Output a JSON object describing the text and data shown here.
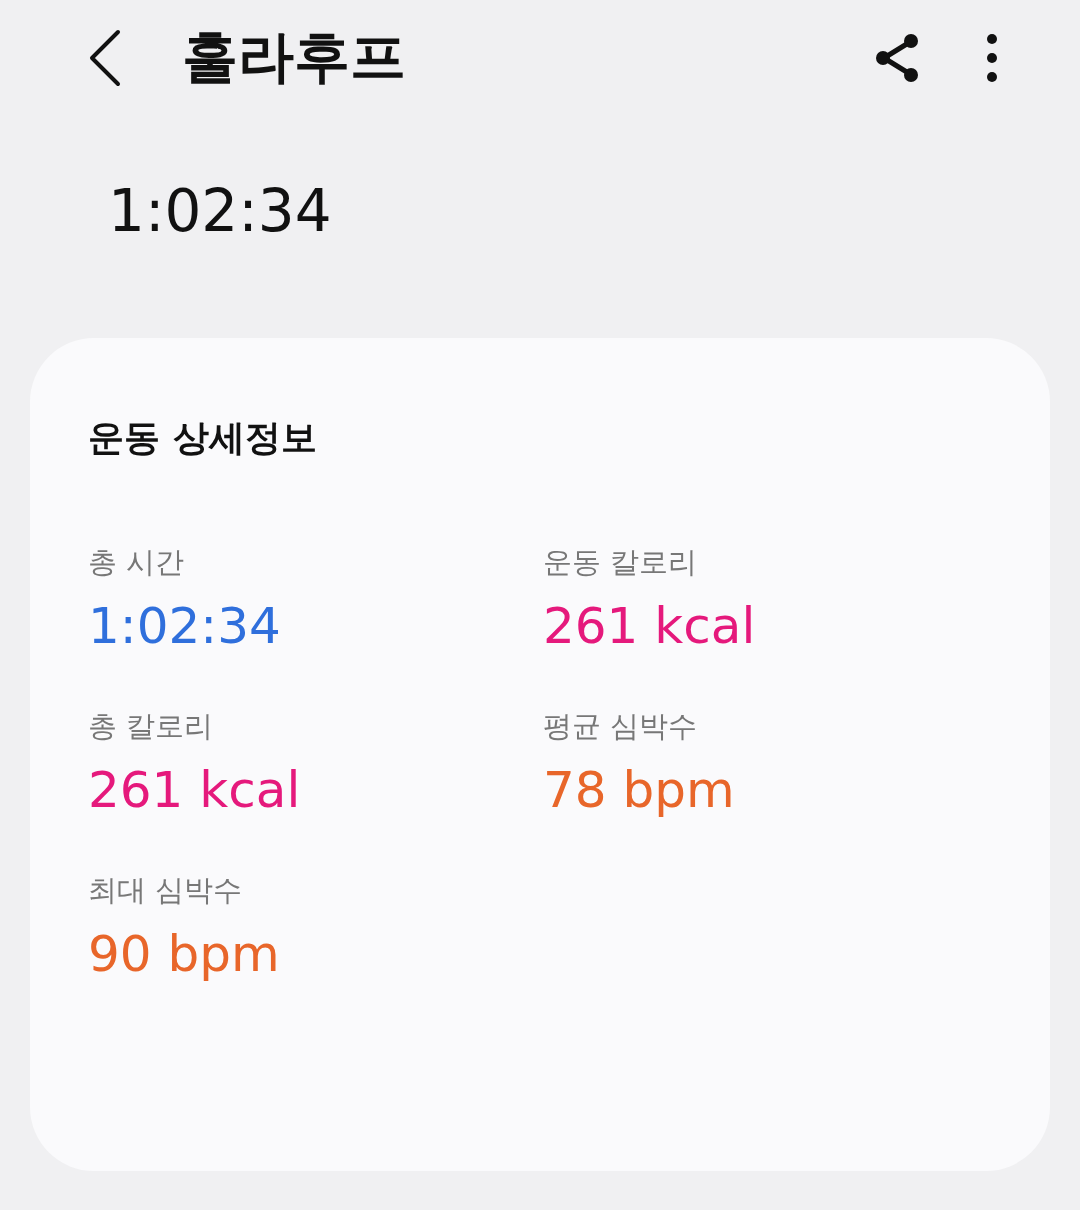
{
  "header": {
    "title": "훌라후프"
  },
  "duration": "1:02:34",
  "details": {
    "title": "운동 상세정보",
    "stats": [
      {
        "label": "총 시간",
        "value": "1:02:34",
        "color": "#2f6fdc"
      },
      {
        "label": "운동 칼로리",
        "value": "261 kcal",
        "color": "#e5197c"
      },
      {
        "label": "총 칼로리",
        "value": "261 kcal",
        "color": "#e5197c"
      },
      {
        "label": "평균 심박수",
        "value": "78 bpm",
        "color": "#e8662a"
      },
      {
        "label": "최대 심박수",
        "value": "90 bpm",
        "color": "#e8662a"
      }
    ]
  }
}
